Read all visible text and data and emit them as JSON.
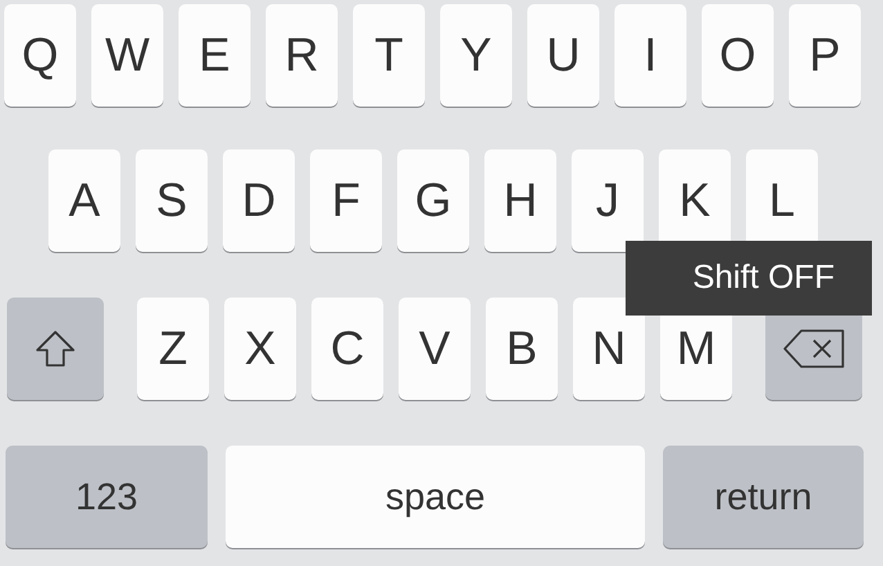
{
  "rows": [
    [
      "Q",
      "W",
      "E",
      "R",
      "T",
      "Y",
      "U",
      "I",
      "O",
      "P"
    ],
    [
      "A",
      "S",
      "D",
      "F",
      "G",
      "H",
      "J",
      "K",
      "L"
    ],
    [
      "Z",
      "X",
      "C",
      "V",
      "B",
      "N",
      "M"
    ]
  ],
  "shift_on": false,
  "bottom_row": {
    "numbers": "123",
    "space": "space",
    "return": "return"
  },
  "tooltip": "Shift OFF"
}
